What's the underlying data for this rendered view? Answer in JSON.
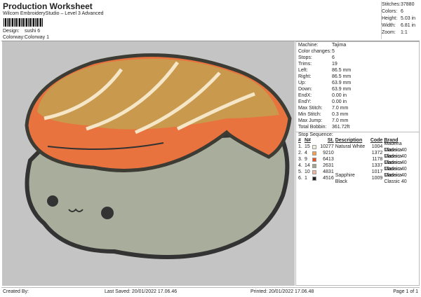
{
  "header": {
    "title": "Production Worksheet",
    "subtitle": "Wilcom EmbroideryStudio – Level 3 Advanced",
    "design_label": "Design:",
    "design": "sushi 6",
    "colorway_label": "Colorway:",
    "colorway": "Colorway 1"
  },
  "stats": [
    {
      "k": "Stitches:",
      "v": "37880"
    },
    {
      "k": "Colors:",
      "v": "6"
    },
    {
      "k": "Height:",
      "v": "5.03 in"
    },
    {
      "k": "Width:",
      "v": "6.81 in"
    },
    {
      "k": "Zoom:",
      "v": "1:1"
    }
  ],
  "details": [
    {
      "k": "Machine:",
      "v": "Tajima"
    },
    {
      "k": "Color changes:",
      "v": "5"
    },
    {
      "k": "Stops:",
      "v": "6"
    },
    {
      "k": "Trims:",
      "v": "19"
    },
    {
      "k": "Left:",
      "v": "86.5 mm"
    },
    {
      "k": "Right:",
      "v": "86.5 mm"
    },
    {
      "k": "Up:",
      "v": "63.9 mm"
    },
    {
      "k": "Down:",
      "v": "63.9 mm"
    },
    {
      "k": "EndX:",
      "v": "0.00 in"
    },
    {
      "k": "EndY:",
      "v": "0.00 in"
    },
    {
      "k": "Max Stitch:",
      "v": "7.0 mm"
    },
    {
      "k": "Min Stitch:",
      "v": "0.3 mm"
    },
    {
      "k": "Max Jump:",
      "v": "7.0 mm"
    },
    {
      "k": "Total Bobbin:",
      "v": "361.72ft"
    }
  ],
  "sequence": {
    "title": "Stop Sequence:",
    "headers": [
      "#",
      "N#",
      "St.",
      "Description",
      "Code",
      "Brand"
    ],
    "rows": [
      {
        "n": "1.",
        "nn": "15",
        "color": "#f0ece0",
        "st": "10277",
        "desc": "Natural White",
        "code": "1004",
        "brand": "Madeira Classic 40"
      },
      {
        "n": "2.",
        "nn": "4",
        "color": "#f2a24e",
        "st": "9210",
        "desc": "",
        "code": "1372",
        "brand": "Madeira Classic 40"
      },
      {
        "n": "3.",
        "nn": "9",
        "color": "#e4532e",
        "st": "6413",
        "desc": "",
        "code": "1178",
        "brand": "Madeira Classic 40"
      },
      {
        "n": "4.",
        "nn": "14",
        "color": "#a3a68e",
        "st": "2631",
        "desc": "",
        "code": "1337",
        "brand": "Madeira Classic 40"
      },
      {
        "n": "5.",
        "nn": "10",
        "color": "#f2b4a2",
        "st": "4831",
        "desc": "",
        "code": "1017",
        "brand": "Madeira Classic 40"
      },
      {
        "n": "6.",
        "nn": "1",
        "color": "#222222",
        "st": "4516",
        "desc": "Sapphire Black",
        "code": "1009",
        "brand": "Madeira Classic 40"
      }
    ]
  },
  "footer": {
    "created": "Created By:",
    "saved": "Last Saved: 20/01/2022 17.06.46",
    "printed": "Printed: 20/01/2022 17.06.48",
    "page": "Page 1 of 1"
  }
}
